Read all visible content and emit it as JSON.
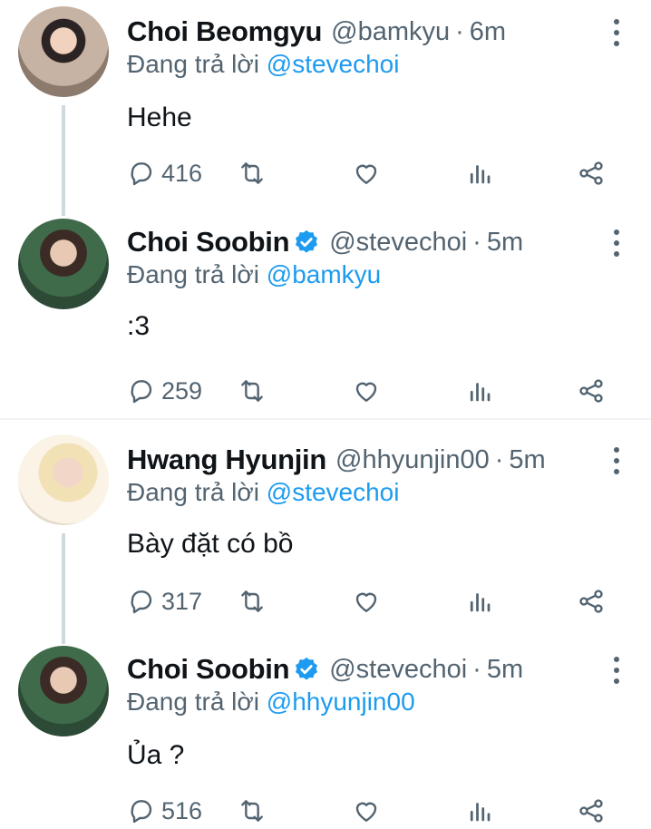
{
  "reply_prefix": "Đang trả lời",
  "tweets": [
    {
      "name": "Choi Beomgyu",
      "handle": "@bamkyu",
      "separator": "·",
      "time": "6m",
      "verified": false,
      "replying_to": "@stevechoi",
      "text": "Hehe",
      "reply_count": "416"
    },
    {
      "name": "Choi Soobin",
      "handle": "@stevechoi",
      "separator": "·",
      "time": "5m",
      "verified": true,
      "replying_to": "@bamkyu",
      "text": ":3",
      "reply_count": "259"
    },
    {
      "name": "Hwang Hyunjin",
      "handle": "@hhyunjin00",
      "separator": "·",
      "time": "5m",
      "verified": false,
      "replying_to": "@stevechoi",
      "text": "Bày đặt có bồ",
      "reply_count": "317"
    },
    {
      "name": "Choi Soobin",
      "handle": "@stevechoi",
      "separator": "·",
      "time": "5m",
      "verified": true,
      "replying_to": "@hhyunjin00",
      "text": "Ủa ?",
      "reply_count": "516"
    }
  ],
  "icons": {
    "reply": "reply-icon",
    "retweet": "retweet-icon",
    "like": "like-icon",
    "views": "views-icon",
    "share": "share-icon",
    "more": "more-options-icon",
    "verified": "verified-badge-icon"
  },
  "colors": {
    "link": "#1d9bf0",
    "secondary_text": "#536471",
    "primary_text": "#0f1419",
    "thread_line": "#cfd9de",
    "divider": "#eff3f4"
  }
}
